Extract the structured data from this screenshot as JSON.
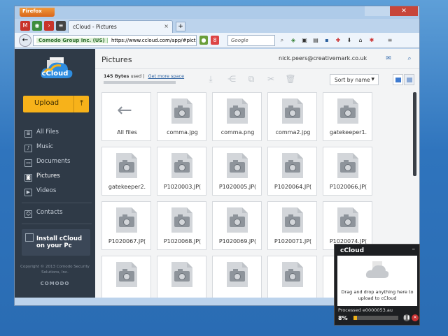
{
  "browser": {
    "app_button": "Firefox",
    "tab_title": "cCloud - Pictures",
    "tab_close": "×",
    "new_tab": "+",
    "identity": "Comodo Group Inc. (US)",
    "url": "https://www.ccloud.com/app/#picture",
    "search_placeholder": "Google"
  },
  "app": {
    "logo_text": "cCloud",
    "upload_label": "Upload",
    "nav": [
      {
        "label": "All Files"
      },
      {
        "label": "Music"
      },
      {
        "label": "Documents"
      },
      {
        "label": "Pictures"
      },
      {
        "label": "Videos"
      }
    ],
    "contacts_label": "Contacts",
    "install_line1": "Install cCloud",
    "install_line2": "on your Pc",
    "copyright": "Copyright © 2013 Comodo Security Solutions, Inc.",
    "brand": "COMODO"
  },
  "main": {
    "title": "Pictures",
    "email": "nick.peers@creativemark.co.uk",
    "storage_used": "145 Bytes",
    "storage_suffix": "used |",
    "get_more": "Get more space",
    "storage_fraction": 0,
    "sort_label": "Sort by name"
  },
  "tiles": [
    {
      "label": "All files",
      "kind": "back"
    },
    {
      "label": "comma.jpg"
    },
    {
      "label": "comma.png"
    },
    {
      "label": "comma2.jpg"
    },
    {
      "label": "gatekeeper1."
    },
    {
      "label": "gatekeeper2."
    },
    {
      "label": "P1020003.JP("
    },
    {
      "label": "P1020005.JP("
    },
    {
      "label": "P1020064.JP("
    },
    {
      "label": "P1020066.JP("
    },
    {
      "label": "P1020067.JP("
    },
    {
      "label": "P1020068.JP("
    },
    {
      "label": "P1020069.JP("
    },
    {
      "label": "P1020071.JP("
    },
    {
      "label": "P1020074.JP("
    },
    {
      "label": ""
    },
    {
      "label": ""
    },
    {
      "label": ""
    },
    {
      "label": ""
    },
    {
      "label": ""
    }
  ],
  "popup": {
    "title": "cCloud",
    "minimize": "–",
    "drop_line1": "Drag and drop anything here to",
    "drop_line2": "upload to cCloud",
    "processed": "Processed e0000053.au",
    "percent": "8%",
    "progress": 0.08
  },
  "colors": {
    "accent": "#f7b21a",
    "sidebar": "#2f3a47",
    "link": "#2a5f9e"
  }
}
